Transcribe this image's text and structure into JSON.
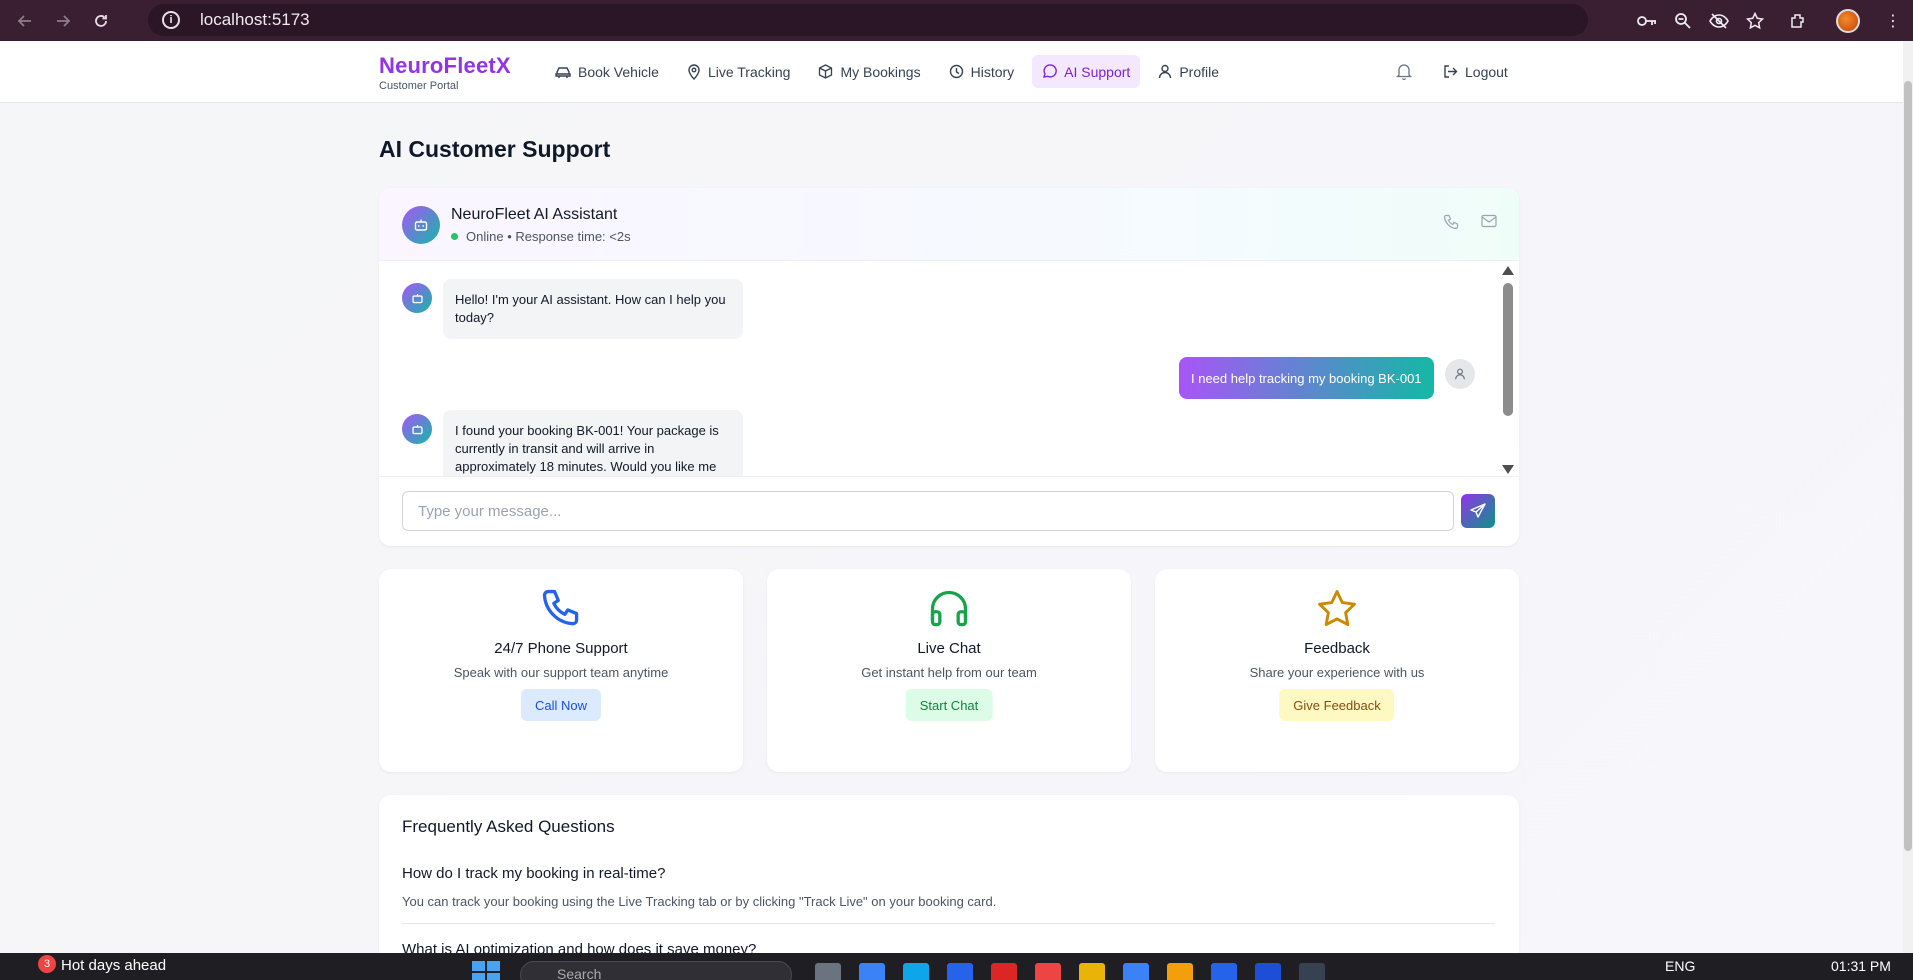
{
  "browser": {
    "url": "localhost:5173"
  },
  "app": {
    "brand": "NeuroFleetX",
    "brand_sub": "Customer Portal",
    "nav": [
      {
        "label": "Book Vehicle",
        "icon": "car-icon"
      },
      {
        "label": "Live Tracking",
        "icon": "map-pin-icon"
      },
      {
        "label": "My Bookings",
        "icon": "package-icon"
      },
      {
        "label": "History",
        "icon": "clock-icon"
      },
      {
        "label": "AI Support",
        "icon": "message-circle-icon",
        "active": true
      },
      {
        "label": "Profile",
        "icon": "user-icon"
      }
    ],
    "logout_label": "Logout"
  },
  "page": {
    "title": "AI Customer Support"
  },
  "chat": {
    "assistant_name": "NeuroFleet AI Assistant",
    "status": "Online • Response time: <2s",
    "messages": [
      {
        "from": "bot",
        "text": "Hello! I'm your AI assistant. How can I help you today?"
      },
      {
        "from": "user",
        "text": "I need help tracking my booking BK-001"
      },
      {
        "from": "bot",
        "text": "I found your booking BK-001! Your package is currently in transit and will arrive in approximately 18 minutes. Would you like me"
      }
    ],
    "input_placeholder": "Type your message..."
  },
  "support_cards": [
    {
      "title": "24/7 Phone Support",
      "desc": "Speak with our support team anytime",
      "button": "Call Now",
      "color": "#2563eb"
    },
    {
      "title": "Live Chat",
      "desc": "Get instant help from our team",
      "button": "Start Chat",
      "color": "#16a34a"
    },
    {
      "title": "Feedback",
      "desc": "Share your experience with us",
      "button": "Give Feedback",
      "color": "#ca8a04"
    }
  ],
  "faq": {
    "title": "Frequently Asked Questions",
    "items": [
      {
        "q": "How do I track my booking in real-time?",
        "a": "You can track your booking using the Live Tracking tab or by clicking \"Track Live\" on your booking card."
      },
      {
        "q": "What is AI optimization and how does it save money?",
        "a": ""
      }
    ]
  },
  "taskbar": {
    "weather_badge": "3",
    "weather_text": "Hot days ahead",
    "search_placeholder": "Search",
    "lang": "ENG",
    "time": "01:31 PM"
  },
  "colors": {
    "brand": "#9333ea",
    "accent_gradient_start": "#a855f7",
    "accent_gradient_end": "#14b8a6",
    "online": "#22c55e"
  }
}
